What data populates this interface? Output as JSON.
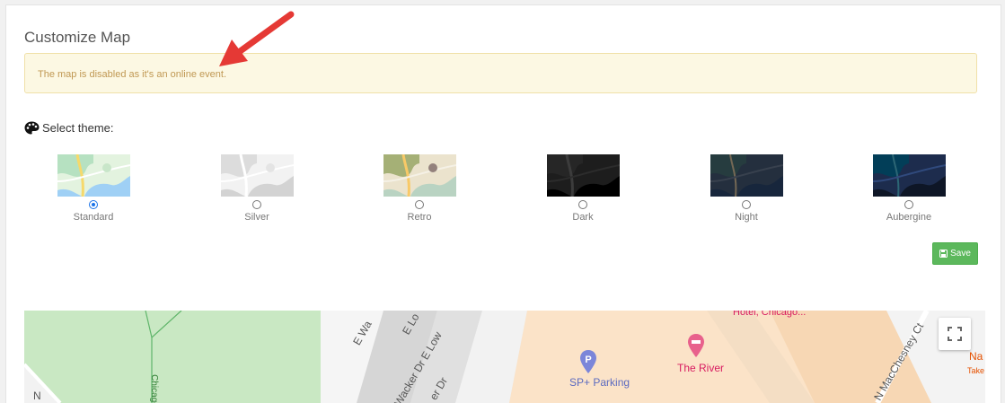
{
  "page": {
    "title": "Customize Map",
    "alert": "The map is disabled as it's an online event.",
    "select_theme_label": "Select theme:",
    "save_label": "Save"
  },
  "themes": [
    {
      "name": "Standard",
      "selected": true
    },
    {
      "name": "Silver",
      "selected": false
    },
    {
      "name": "Retro",
      "selected": false
    },
    {
      "name": "Dark",
      "selected": false
    },
    {
      "name": "Night",
      "selected": false
    },
    {
      "name": "Aubergine",
      "selected": false
    }
  ],
  "map": {
    "parking_label": "SP+ Parking",
    "hotel_label": "The River",
    "hotel_top_label": "Hotel, Chicago...",
    "street_1": "E Wa",
    "street_2": "E Lo",
    "street_3": "Wacker Dr E Low",
    "street_4": "er Dr",
    "street_5": "N MacChesney Ct",
    "street_6": "Chicago",
    "street_7": "N",
    "street_8": "Na",
    "street_9": "Take"
  },
  "colors": {
    "accent": "#1a73e8",
    "save": "#5cb85c",
    "alert_bg": "#fcf8e3",
    "alert_text": "#c09853",
    "annotation_arrow": "#e53935"
  },
  "icons": {
    "palette": "palette-icon",
    "save": "floppy-disk-icon",
    "fullscreen": "fullscreen-icon",
    "parking": "parking-pin-icon",
    "hotel": "hotel-pin-icon"
  }
}
